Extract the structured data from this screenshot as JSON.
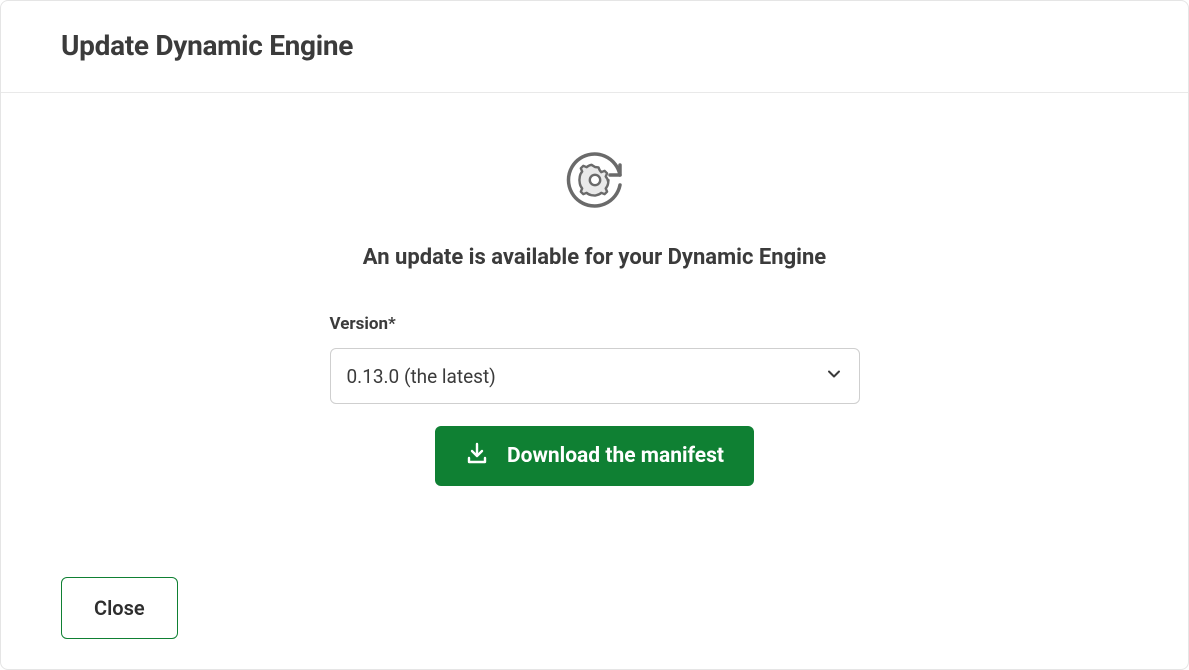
{
  "header": {
    "title": "Update Dynamic Engine"
  },
  "main": {
    "message": "An update is available for your Dynamic Engine",
    "version_label": "Version*",
    "version_selected": "0.13.0 (the latest)",
    "download_label": "Download the manifest"
  },
  "footer": {
    "close_label": "Close"
  },
  "icons": {
    "hero": "gear-refresh-icon",
    "download": "download-icon",
    "chevron": "chevron-down-icon"
  },
  "colors": {
    "accent": "#0f8033",
    "text": "#3b3b3b"
  }
}
